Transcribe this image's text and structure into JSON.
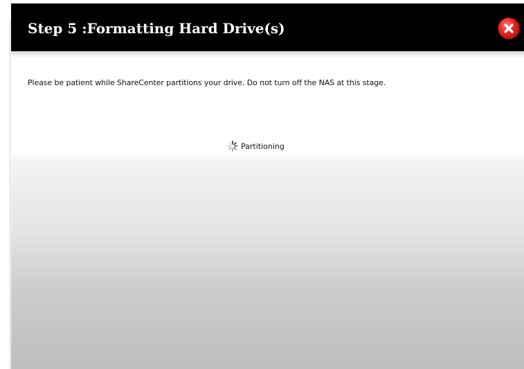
{
  "dialog": {
    "title": "Step 5 :Formatting Hard Drive(s)",
    "close_icon": "close-x-circle-icon",
    "close_color": "#d62020"
  },
  "content": {
    "instruction": "Please be patient while ShareCenter partitions your drive. Do not turn off the NAS at this stage.",
    "status_icon": "loading-spinner-icon",
    "status_label": "Partitioning"
  }
}
